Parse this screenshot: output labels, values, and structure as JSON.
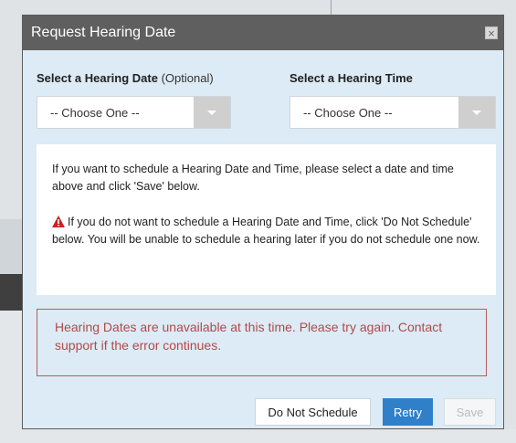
{
  "dialog": {
    "title": "Request Hearing Date",
    "close_glyph": "×"
  },
  "fields": {
    "date_label": "Select a Hearing Date",
    "date_optional": "(Optional)",
    "date_value": "-- Choose One --",
    "time_label": "Select a Hearing Time",
    "time_value": "-- Choose One --"
  },
  "info": {
    "line1": "If you want to schedule a Hearing Date and Time, please select a date and time above and click 'Save' below.",
    "line2": "If you do not want to schedule a Hearing Date and Time, click 'Do Not Schedule' below. You will be unable to schedule a hearing later if you do not schedule one now."
  },
  "error": {
    "message": "Hearing Dates are unavailable at this time. Please try again. Contact support if the error continues."
  },
  "buttons": {
    "do_not_schedule": "Do Not Schedule",
    "retry": "Retry",
    "save": "Save"
  },
  "colors": {
    "dialog_bg": "#dcebf5",
    "titlebar": "#5f5f5f",
    "primary": "#2f80c9",
    "error": "#b04a4a",
    "warning": "#cc2222"
  }
}
